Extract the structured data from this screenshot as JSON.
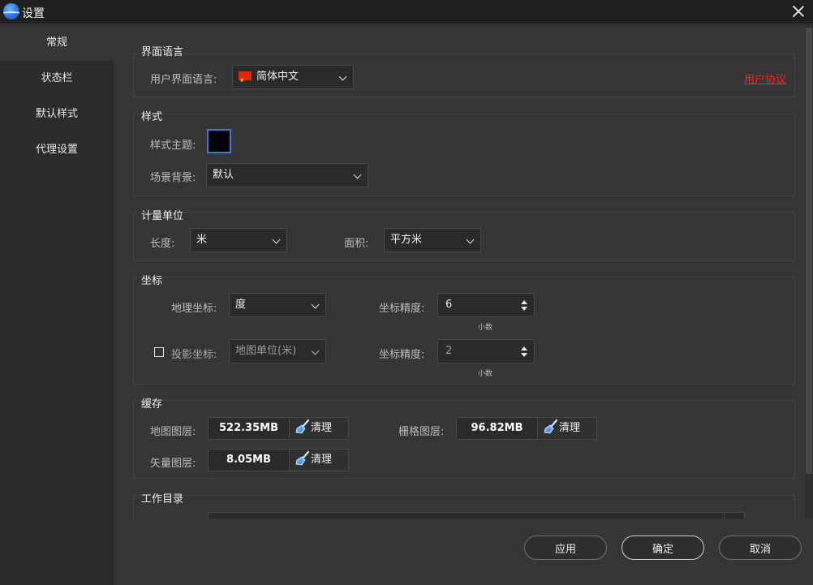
{
  "window": {
    "title": "设置"
  },
  "sidebar": {
    "items": [
      {
        "label": "常规"
      },
      {
        "label": "状态栏"
      },
      {
        "label": "默认样式"
      },
      {
        "label": "代理设置"
      }
    ]
  },
  "language": {
    "title": "界面语言",
    "label": "用户界面语言:",
    "value": "简体中文",
    "agreement_link": "用户协议"
  },
  "style": {
    "title": "样式",
    "theme_label": "样式主题:",
    "theme_color": "#000000",
    "background_label": "场景背景:",
    "background_value": "默认"
  },
  "units": {
    "title": "计量单位",
    "length_label": "长度:",
    "length_value": "米",
    "area_label": "面积:",
    "area_value": "平方米"
  },
  "coordinates": {
    "title": "坐标",
    "geo_label": "地理坐标:",
    "geo_value": "度",
    "geo_precision_label": "坐标精度:",
    "geo_precision_value": "6",
    "geo_precision_hint": "小数",
    "proj_label": "投影坐标:",
    "proj_value": "地图单位(米)",
    "proj_precision_label": "坐标精度:",
    "proj_precision_value": "2",
    "proj_precision_hint": "小数"
  },
  "cache": {
    "title": "缓存",
    "map_label": "地图图层:",
    "map_size": "522.35MB",
    "raster_label": "栅格图层:",
    "raster_size": "96.82MB",
    "vector_label": "矢量图层:",
    "vector_size": "8.05MB",
    "clear_label": "清理"
  },
  "workdir": {
    "title": "工作目录"
  },
  "footer": {
    "apply": "应用",
    "ok": "确定",
    "cancel": "取消"
  }
}
